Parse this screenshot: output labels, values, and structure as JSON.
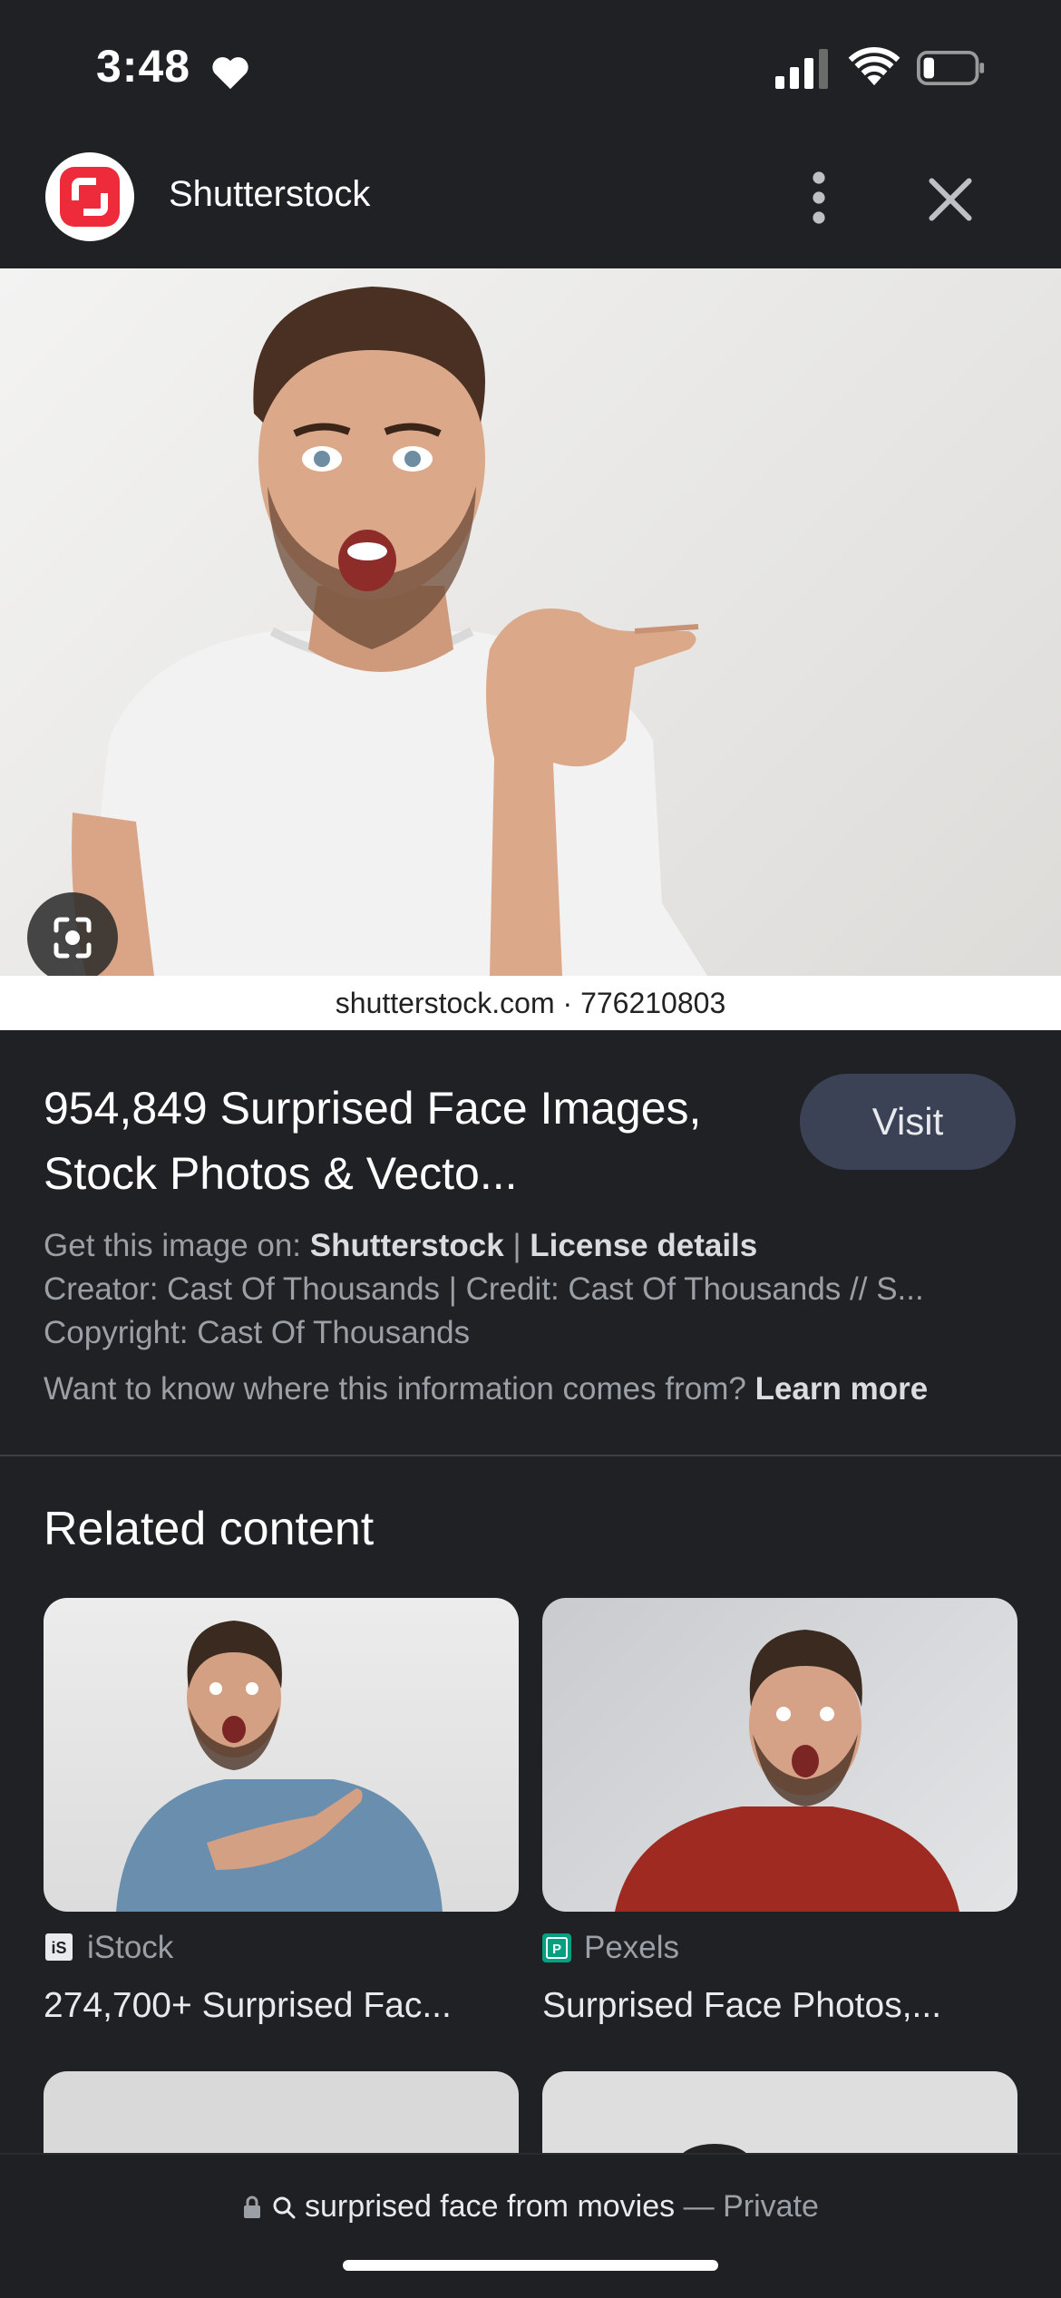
{
  "status_bar": {
    "time": "3:48"
  },
  "header": {
    "site_name": "Shutterstock"
  },
  "hero": {
    "caption": "shutterstock.com · 776210803"
  },
  "info": {
    "title": "954,849 Surprised Face Images, Stock Photos & Vecto...",
    "visit_label": "Visit",
    "get_image_prefix": "Get this image on:",
    "source_link": "Shutterstock",
    "separator": "|",
    "license_link": "License details",
    "creator_line": "Creator: Cast Of Thousands | Credit: Cast Of Thousands // S...",
    "copyright_line": "Copyright: Cast Of Thousands",
    "info_question": "Want to know where this information comes from?",
    "learn_more": "Learn more"
  },
  "related": {
    "heading": "Related content",
    "cards": [
      {
        "source": "iStock",
        "title": "274,700+ Surprised Fac..."
      },
      {
        "source": "Pexels",
        "title": "Surprised Face Photos,..."
      }
    ]
  },
  "bottom_bar": {
    "query": "surprised face from movies",
    "dash": "—",
    "mode": "Private"
  },
  "colors": {
    "background": "#202124",
    "visit_button": "#3c4256",
    "shutterstock_red": "#ee2b3b",
    "pexels_green": "#05a081"
  }
}
